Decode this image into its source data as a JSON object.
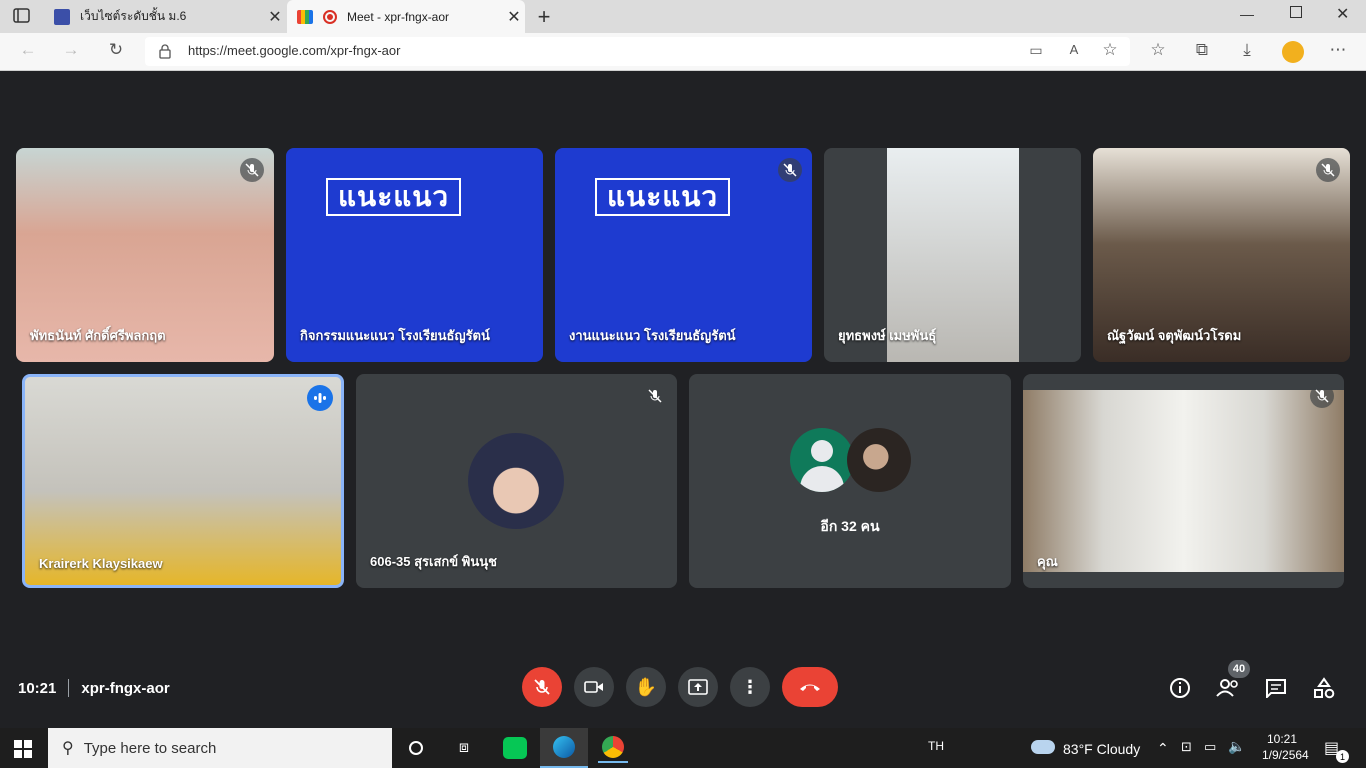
{
  "browser": {
    "tabs": [
      {
        "title": "เว็บไซต์ระดับชั้น ม.6",
        "active": false
      },
      {
        "title": "Meet - xpr-fngx-aor",
        "active": true
      }
    ],
    "url": "https://meet.google.com/xpr-fngx-aor",
    "new_tab_icon": "plus-icon"
  },
  "meet": {
    "participants_row1": [
      {
        "name": "พัทธนันท์ ศักดิ์ศรีพลกฤต",
        "muted": true
      },
      {
        "name": "กิจกรรมแนะแนว โรงเรียนธัญรัตน์",
        "muted": false,
        "banner": "แนะแนว"
      },
      {
        "name": "งานแนะแนว โรงเรียนธัญรัตน์",
        "muted": true,
        "banner": "แนะแนว"
      },
      {
        "name": "ยุทธพงษ์ เมษพันธุ์",
        "muted": false
      },
      {
        "name": "ณัฐวัฒน์ จตุพัฒน์วโรดม",
        "muted": true
      }
    ],
    "participants_row2": [
      {
        "name": "Krairerk Klaysikaew",
        "speaking": true
      },
      {
        "name": "606-35 สุรเสกข์ พินนุช",
        "muted": true
      },
      {
        "name": "",
        "more_label": "อีก 32 คน"
      },
      {
        "name": "คุณ",
        "muted": true
      }
    ],
    "time": "10:21",
    "meeting_code": "xpr-fngx-aor",
    "people_count": "40",
    "accent_red": "#ea4335",
    "speaking_blue": "#1a73e8"
  },
  "taskbar": {
    "search_placeholder": "Type here to search",
    "language": "TH",
    "weather": "83°F  Cloudy",
    "clock_time": "10:21",
    "clock_date": "1/9/2564",
    "notification_count": "1"
  }
}
